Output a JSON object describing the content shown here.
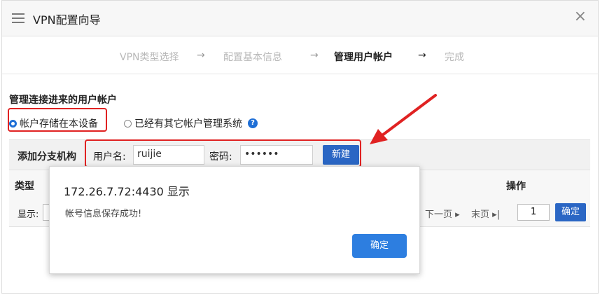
{
  "window": {
    "title": "VPN配置向导",
    "close_glyph": "×"
  },
  "steps": [
    {
      "label": "VPN类型选择",
      "state": "done"
    },
    {
      "label": "配置基本信息",
      "state": "done"
    },
    {
      "label": "管理用户帐户",
      "state": "active"
    },
    {
      "label": "完成",
      "state": "pending"
    }
  ],
  "step_arrow": "→",
  "section": {
    "title": "管理连接进来的用户帐户"
  },
  "radios": [
    {
      "label": "帐户存储在本设备",
      "checked": true
    },
    {
      "label": "已经有其它帐户管理系统",
      "checked": false
    }
  ],
  "help_glyph": "?",
  "toolbar": {
    "add_branch_label": "添加分支机构",
    "username_label": "用户名:",
    "username_value": "ruijie",
    "password_label": "密码:",
    "password_value": "••••••",
    "new_button": "新建"
  },
  "table": {
    "headers": [
      "类型",
      "操作"
    ]
  },
  "pager": {
    "show_label": "显示:",
    "next_page": "下一页 ▸",
    "last_page": "末页 ▸|",
    "page_number": "1",
    "confirm_button": "确定"
  },
  "dialog": {
    "title": "172.26.7.72:4430 显示",
    "message": "帐号信息保存成功!",
    "ok_button": "确定"
  },
  "colors": {
    "accent_blue": "#2a66c4",
    "highlight_red": "#e02222"
  }
}
